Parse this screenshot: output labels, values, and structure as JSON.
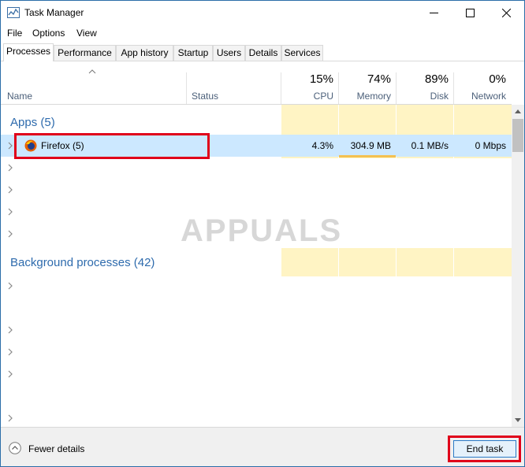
{
  "window": {
    "title": "Task Manager"
  },
  "menu": [
    "File",
    "Options",
    "View"
  ],
  "tabs": [
    "Processes",
    "Performance",
    "App history",
    "Startup",
    "Users",
    "Details",
    "Services"
  ],
  "columns": {
    "name": "Name",
    "status": "Status",
    "cpu": {
      "pct": "15%",
      "label": "CPU"
    },
    "memory": {
      "pct": "74%",
      "label": "Memory"
    },
    "disk": {
      "pct": "89%",
      "label": "Disk"
    },
    "network": {
      "pct": "0%",
      "label": "Network"
    }
  },
  "groups": {
    "apps": "Apps (5)",
    "background": "Background processes (42)"
  },
  "firefox": {
    "name": "Firefox (5)",
    "cpu": "4.3%",
    "memory": "304.9 MB",
    "disk": "0.1 MB/s",
    "network": "0 Mbps"
  },
  "footer": {
    "fewer_details": "Fewer details",
    "end_task": "End task"
  },
  "watermark": "APPUALS",
  "colors": {
    "accent": "#2e6bad",
    "highlight": "#e0001a",
    "selection": "#cce8ff",
    "heat": "#fff4c4"
  }
}
